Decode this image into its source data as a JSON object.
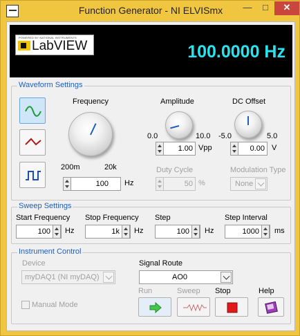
{
  "window": {
    "title": "Function Generator - NI ELVISmx"
  },
  "header": {
    "logo_small": "POWERED BY NATIONAL INSTRUMENTS",
    "logo_text": "LabVIEW",
    "frequency_display": "100.0000 Hz",
    "display_color": "#27e4f0"
  },
  "waveform": {
    "title": "Waveform Settings",
    "frequency": {
      "label": "Frequency",
      "min": "200m",
      "max": "20k",
      "value": "100",
      "unit": "Hz"
    },
    "amplitude": {
      "label": "Amplitude",
      "min": "0.0",
      "max": "10.0",
      "value": "1.00",
      "unit": "Vpp"
    },
    "dc_offset": {
      "label": "DC Offset",
      "min": "-5.0",
      "max": "5.0",
      "value": "0.00",
      "unit": "V"
    },
    "duty_cycle": {
      "label": "Duty Cycle",
      "value": "50",
      "unit": "%"
    },
    "modulation": {
      "label": "Modulation Type",
      "value": "None"
    },
    "waveforms": [
      "sine",
      "triangle",
      "square"
    ],
    "selected": "sine"
  },
  "sweep": {
    "title": "Sweep Settings",
    "start": {
      "label": "Start Frequency",
      "value": "100",
      "unit": "Hz"
    },
    "stop": {
      "label": "Stop Frequency",
      "value": "1k",
      "unit": "Hz"
    },
    "step": {
      "label": "Step",
      "value": "100",
      "unit": "Hz"
    },
    "interval": {
      "label": "Step Interval",
      "value": "1000",
      "unit": "ms"
    }
  },
  "instrument": {
    "title": "Instrument Control",
    "device_label": "Device",
    "device_value": "myDAQ1 (NI myDAQ)",
    "route_label": "Signal Route",
    "route_value": "AO0",
    "manual_mode": "Manual Mode",
    "run_label": "Run",
    "sweep_label": "Sweep",
    "stop_label": "Stop",
    "help_label": "Help"
  }
}
